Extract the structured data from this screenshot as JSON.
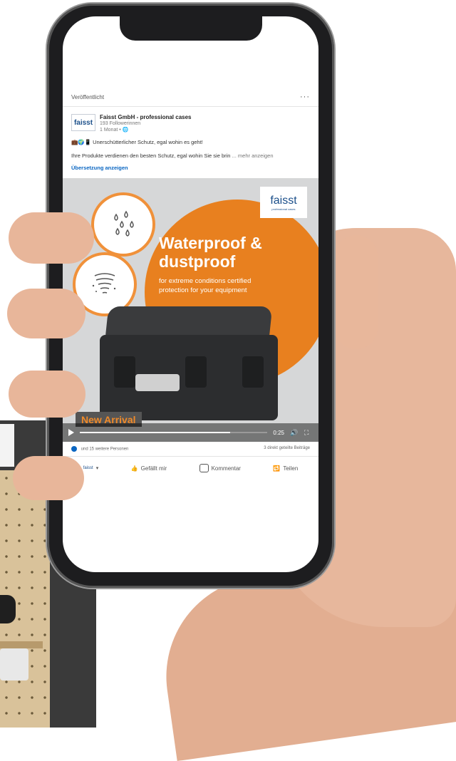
{
  "post": {
    "status_label": "Veröffentlicht",
    "more_menu": "···",
    "author": {
      "logo_text": "faisst",
      "name": "Faisst GmbH - professional cases",
      "followers": "193 Followerinnen",
      "time": "1 Monat •"
    },
    "emoji_line": "💼🌍📱 Unerschütterlicher Schutz, egal wohin es geht!",
    "body_text": "Ihre Produkte verdienen den besten Schutz, egal wohin Sie sie brin",
    "more_link": "... mehr anzeigen",
    "translate_link": "Übersetzung anzeigen"
  },
  "media": {
    "brand_logo": "faisst",
    "brand_tagline": "professional cases",
    "headline_1": "Waterproof &",
    "headline_2": "dustproof",
    "subline_1": "for extreme conditions certified",
    "subline_2": "protection for your equipment",
    "badge": "New Arrival",
    "video_time": "0:25",
    "video_progress": 0.8
  },
  "engagement": {
    "reactions": "und 15 weitere Personen",
    "shares": "3 direkt geteilte Beiträge"
  },
  "actions": {
    "like": "Gefällt mir",
    "comment": "Kommentar",
    "share": "Teilen"
  },
  "colors": {
    "accent_orange": "#e8801f",
    "linkedin_blue": "#0a66c2"
  }
}
